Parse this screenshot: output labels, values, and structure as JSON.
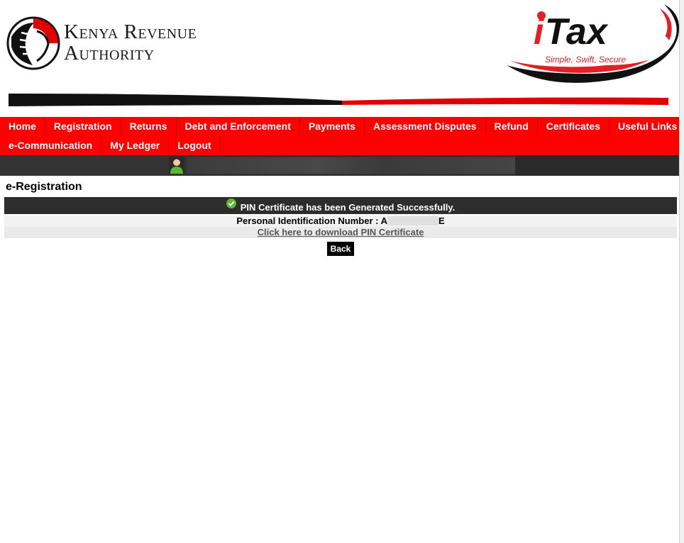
{
  "brand": {
    "kra_line1": "Kenya Revenue",
    "kra_line2": "Authority",
    "itax_i": "i",
    "itax_tax": "Tax",
    "itax_tagline": "Simple, Swift, Secure",
    "colors": {
      "red": "#ff0000",
      "dark": "#333333",
      "success": "#5cb82e"
    }
  },
  "nav": {
    "row1": [
      "Home",
      "Registration",
      "Returns",
      "Debt and Enforcement",
      "Payments",
      "Assessment Disputes",
      "Refund",
      "Certificates",
      "Useful Links"
    ],
    "row2": [
      "e-Communication",
      "My Ledger",
      "Logout"
    ]
  },
  "page": {
    "title": "e-Registration",
    "success_message": "PIN Certificate has been Generated Successfully.",
    "pin_label": "Personal Identification Number : A",
    "pin_suffix": "E",
    "download_link": "Click here to download PIN Certificate",
    "back_label": "Back"
  }
}
